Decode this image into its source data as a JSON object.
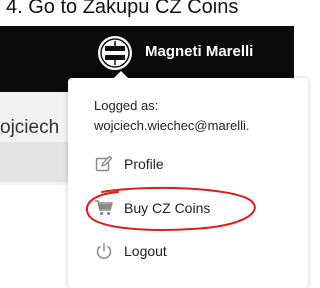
{
  "caption": {
    "text": "4. Go to Zakupu CZ Coins"
  },
  "header": {
    "brand_name": "Magneti Marelli",
    "logo_text": "MAGNETI MARELLI"
  },
  "background": {
    "visible_name": "ojciech"
  },
  "dropdown": {
    "logged_as_label": "Logged as:",
    "email": "wojciech.wiechec@marelli.",
    "items": [
      {
        "label": "Profile",
        "icon": "edit-icon"
      },
      {
        "label": "Buy CZ Coins",
        "icon": "cart-icon"
      },
      {
        "label": "Logout",
        "icon": "power-icon"
      }
    ]
  },
  "colors": {
    "topbar": "#0b0b0b",
    "annotation": "#e21b1b",
    "icon_gray": "#8a8a8a"
  }
}
